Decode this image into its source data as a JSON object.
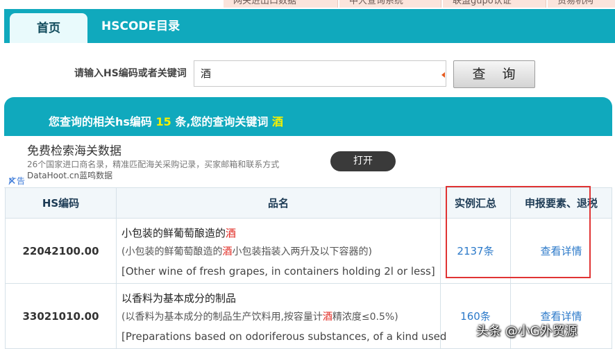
{
  "top_links": [
    "网关进出口数据",
    "中大查询系统",
    "联盟gupo认证",
    "贸易机构"
  ],
  "tabs": {
    "home": "首页",
    "catalog": "HSCODE目录"
  },
  "search": {
    "label": "请输入HS编码或者关键词",
    "value": "酒",
    "button": "查 询"
  },
  "result": {
    "prefix": "您查询的相关hs编码",
    "count": "15",
    "middle": "条,您的查询关键词",
    "keyword": "酒"
  },
  "ad": {
    "title": "免费检索海关数据",
    "desc": "26个国家进口商名录，精准匹配海关采购记录，买家邮箱和联系方式",
    "site": "DataHoot.cn蓝鸣数据",
    "button": "打开",
    "label": "广告",
    "close": "✕"
  },
  "table": {
    "headers": {
      "code": "HS编码",
      "name": "品名",
      "cases": "实例汇总",
      "details": "申报要素、退税"
    },
    "rows": [
      {
        "code": "22042100.00",
        "name_pre": "小包装的鲜葡萄酿造的",
        "name_kw": "酒",
        "name_post": "",
        "desc_pre": "(小包装的鲜葡萄酿造的",
        "desc_kw": "酒",
        "desc_post": "小包装指装入两升及以下容器的)",
        "english": "[Other wine of fresh grapes, in containers holding 2l or less]",
        "cases": "2137条",
        "details": "查看详情"
      },
      {
        "code": "33021010.00",
        "name_pre": "以香料为基本成分的制品",
        "name_kw": "",
        "name_post": "",
        "desc_pre": "(以香料为基本成分的制品生产饮料用,按容量计",
        "desc_kw": "酒",
        "desc_post": "精浓度≤0.5%)",
        "english": "[Preparations based on odoriferous substances, of a kind used",
        "cases": "160条",
        "details": "查看详情"
      }
    ]
  },
  "watermark": "头条 @小G外贸源",
  "colors": {
    "teal": "#10a9bd",
    "highlight": "#f6f000",
    "keyword_red": "#e0241d",
    "link_blue": "#2b79c9",
    "annotation_box": "#e03333"
  }
}
